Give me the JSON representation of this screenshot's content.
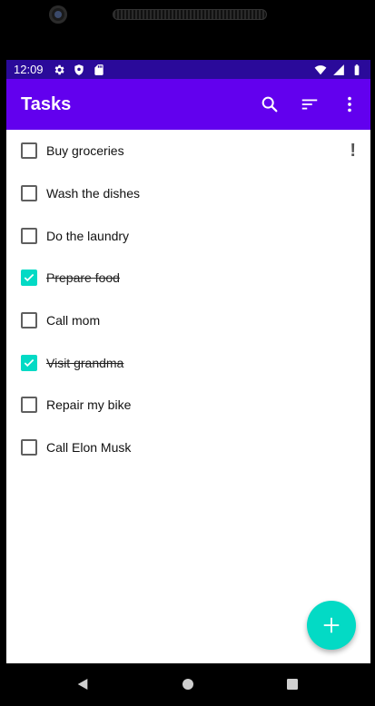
{
  "status_bar": {
    "time": "12:09",
    "left_icons": [
      "settings-icon",
      "shield-icon",
      "sd-card-icon"
    ],
    "right_icons": [
      "wifi-icon",
      "signal-icon",
      "battery-icon"
    ],
    "background": "#2a0a9a"
  },
  "app_bar": {
    "title": "Tasks",
    "actions": [
      "search-icon",
      "sort-icon",
      "more-vert-icon"
    ],
    "background": "#6200ee"
  },
  "tasks": [
    {
      "label": "Buy groceries",
      "checked": false,
      "priority_marker": "!"
    },
    {
      "label": "Wash the dishes",
      "checked": false
    },
    {
      "label": "Do the laundry",
      "checked": false
    },
    {
      "label": "Prepare food",
      "checked": true
    },
    {
      "label": "Call mom",
      "checked": false
    },
    {
      "label": "Visit grandma",
      "checked": true
    },
    {
      "label": "Repair my bike",
      "checked": false
    },
    {
      "label": "Call Elon Musk",
      "checked": false
    }
  ],
  "fab": {
    "icon": "add-icon",
    "color": "#03dac5"
  },
  "nav_bar": {
    "buttons": [
      "back-icon",
      "home-icon",
      "recents-icon"
    ]
  }
}
